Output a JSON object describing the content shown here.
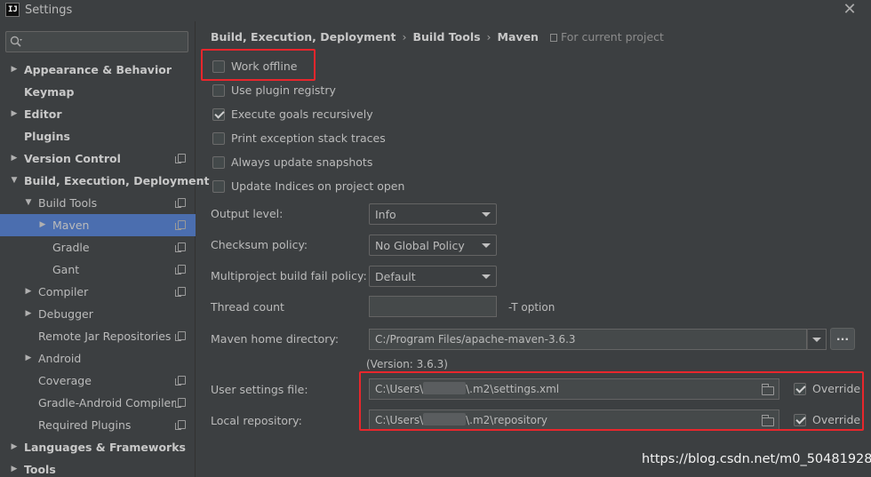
{
  "window": {
    "logo_text": "IJ",
    "title": "Settings",
    "close_glyph": "✕"
  },
  "sidebar": {
    "search_placeholder": "",
    "items": [
      {
        "label": "Appearance & Behavior",
        "bold": true,
        "expandable": true
      },
      {
        "label": "Keymap",
        "bold": true
      },
      {
        "label": "Editor",
        "bold": true,
        "expandable": true
      },
      {
        "label": "Plugins",
        "bold": true
      },
      {
        "label": "Version Control",
        "bold": true,
        "expandable": true,
        "project_icon": true
      },
      {
        "label": "Build, Execution, Deployment",
        "bold": true,
        "expanded": true
      },
      {
        "label": "Build Tools",
        "expanded": true,
        "project_icon": true
      },
      {
        "label": "Maven",
        "expandable": true,
        "selected": true,
        "project_icon": true
      },
      {
        "label": "Gradle",
        "project_icon": true
      },
      {
        "label": "Gant",
        "project_icon": true
      },
      {
        "label": "Compiler",
        "expandable": true,
        "project_icon": true
      },
      {
        "label": "Debugger",
        "expandable": true
      },
      {
        "label": "Remote Jar Repositories",
        "project_icon": true
      },
      {
        "label": "Android",
        "expandable": true
      },
      {
        "label": "Coverage",
        "project_icon": true
      },
      {
        "label": "Gradle-Android Compiler",
        "project_icon": true
      },
      {
        "label": "Required Plugins",
        "project_icon": true
      },
      {
        "label": "Languages & Frameworks",
        "bold": true,
        "expandable": true
      },
      {
        "label": "Tools",
        "bold": true,
        "expandable": true
      }
    ]
  },
  "header": {
    "breadcrumb": [
      "Build, Execution, Deployment",
      "Build Tools",
      "Maven"
    ],
    "separator": "›",
    "scope_note": "For current project"
  },
  "options": [
    {
      "label": "Work offline",
      "checked": false
    },
    {
      "label": "Use plugin registry",
      "checked": false
    },
    {
      "label": "Execute goals recursively",
      "checked": true
    },
    {
      "label": "Print exception stack traces",
      "checked": false
    },
    {
      "label": "Always update snapshots",
      "checked": false
    },
    {
      "label": "Update Indices on project open",
      "checked": false
    }
  ],
  "form": {
    "output_level": {
      "label": "Output level:",
      "value": "Info"
    },
    "checksum_policy": {
      "label": "Checksum policy:",
      "value": "No Global Policy"
    },
    "fail_policy": {
      "label": "Multiproject build fail policy:",
      "value": "Default"
    },
    "thread_count": {
      "label": "Thread count",
      "value": "",
      "hint": "-T option"
    },
    "maven_home": {
      "label": "Maven home directory:",
      "value": "C:/Program Files/apache-maven-3.6.3",
      "browse_label": "...",
      "version": "(Version: 3.6.3)"
    },
    "user_settings": {
      "label": "User settings file:",
      "value_prefix": "C:\\Users\\",
      "value_suffix": "\\.m2\\settings.xml",
      "override_label": "Override",
      "override_checked": true
    },
    "local_repo": {
      "label": "Local repository:",
      "value_prefix": "C:\\Users\\",
      "value_suffix": "\\.m2\\repository",
      "override_label": "Override",
      "override_checked": true
    }
  },
  "watermark": "https://blog.csdn.net/m0_50481928",
  "colors": {
    "background": "#3c3f41",
    "selection": "#4b6eaf",
    "highlight_border": "#e8262c"
  }
}
